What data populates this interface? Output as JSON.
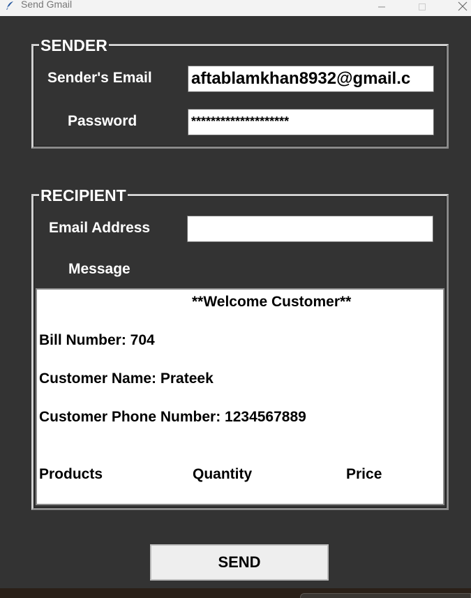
{
  "window": {
    "title": "Send Gmail",
    "icon": "feather-icon",
    "minimize_glyph": "—",
    "maximize_glyph": "☐",
    "close_glyph": "✕"
  },
  "sender": {
    "group_label": "SENDER",
    "email_label": "Sender's Email",
    "email_value": "aftablamkhan8932@gmail.c",
    "password_label": "Password",
    "password_value": "********************"
  },
  "recipient": {
    "group_label": "RECIPIENT",
    "email_label": "Email Address",
    "email_value": "",
    "message_label": "Message",
    "message": {
      "welcome": "**Welcome Customer**",
      "bill_number": "Bill Number: 704",
      "customer_name": "Customer Name: Prateek",
      "customer_phone": "Customer Phone Number: 1234567889",
      "columns": [
        "Products",
        "Quantity",
        "Price"
      ]
    }
  },
  "send_button_label": "SEND",
  "colors": {
    "background": "#333333",
    "text_light": "#ffffff",
    "field_bg": "#ffffff"
  }
}
